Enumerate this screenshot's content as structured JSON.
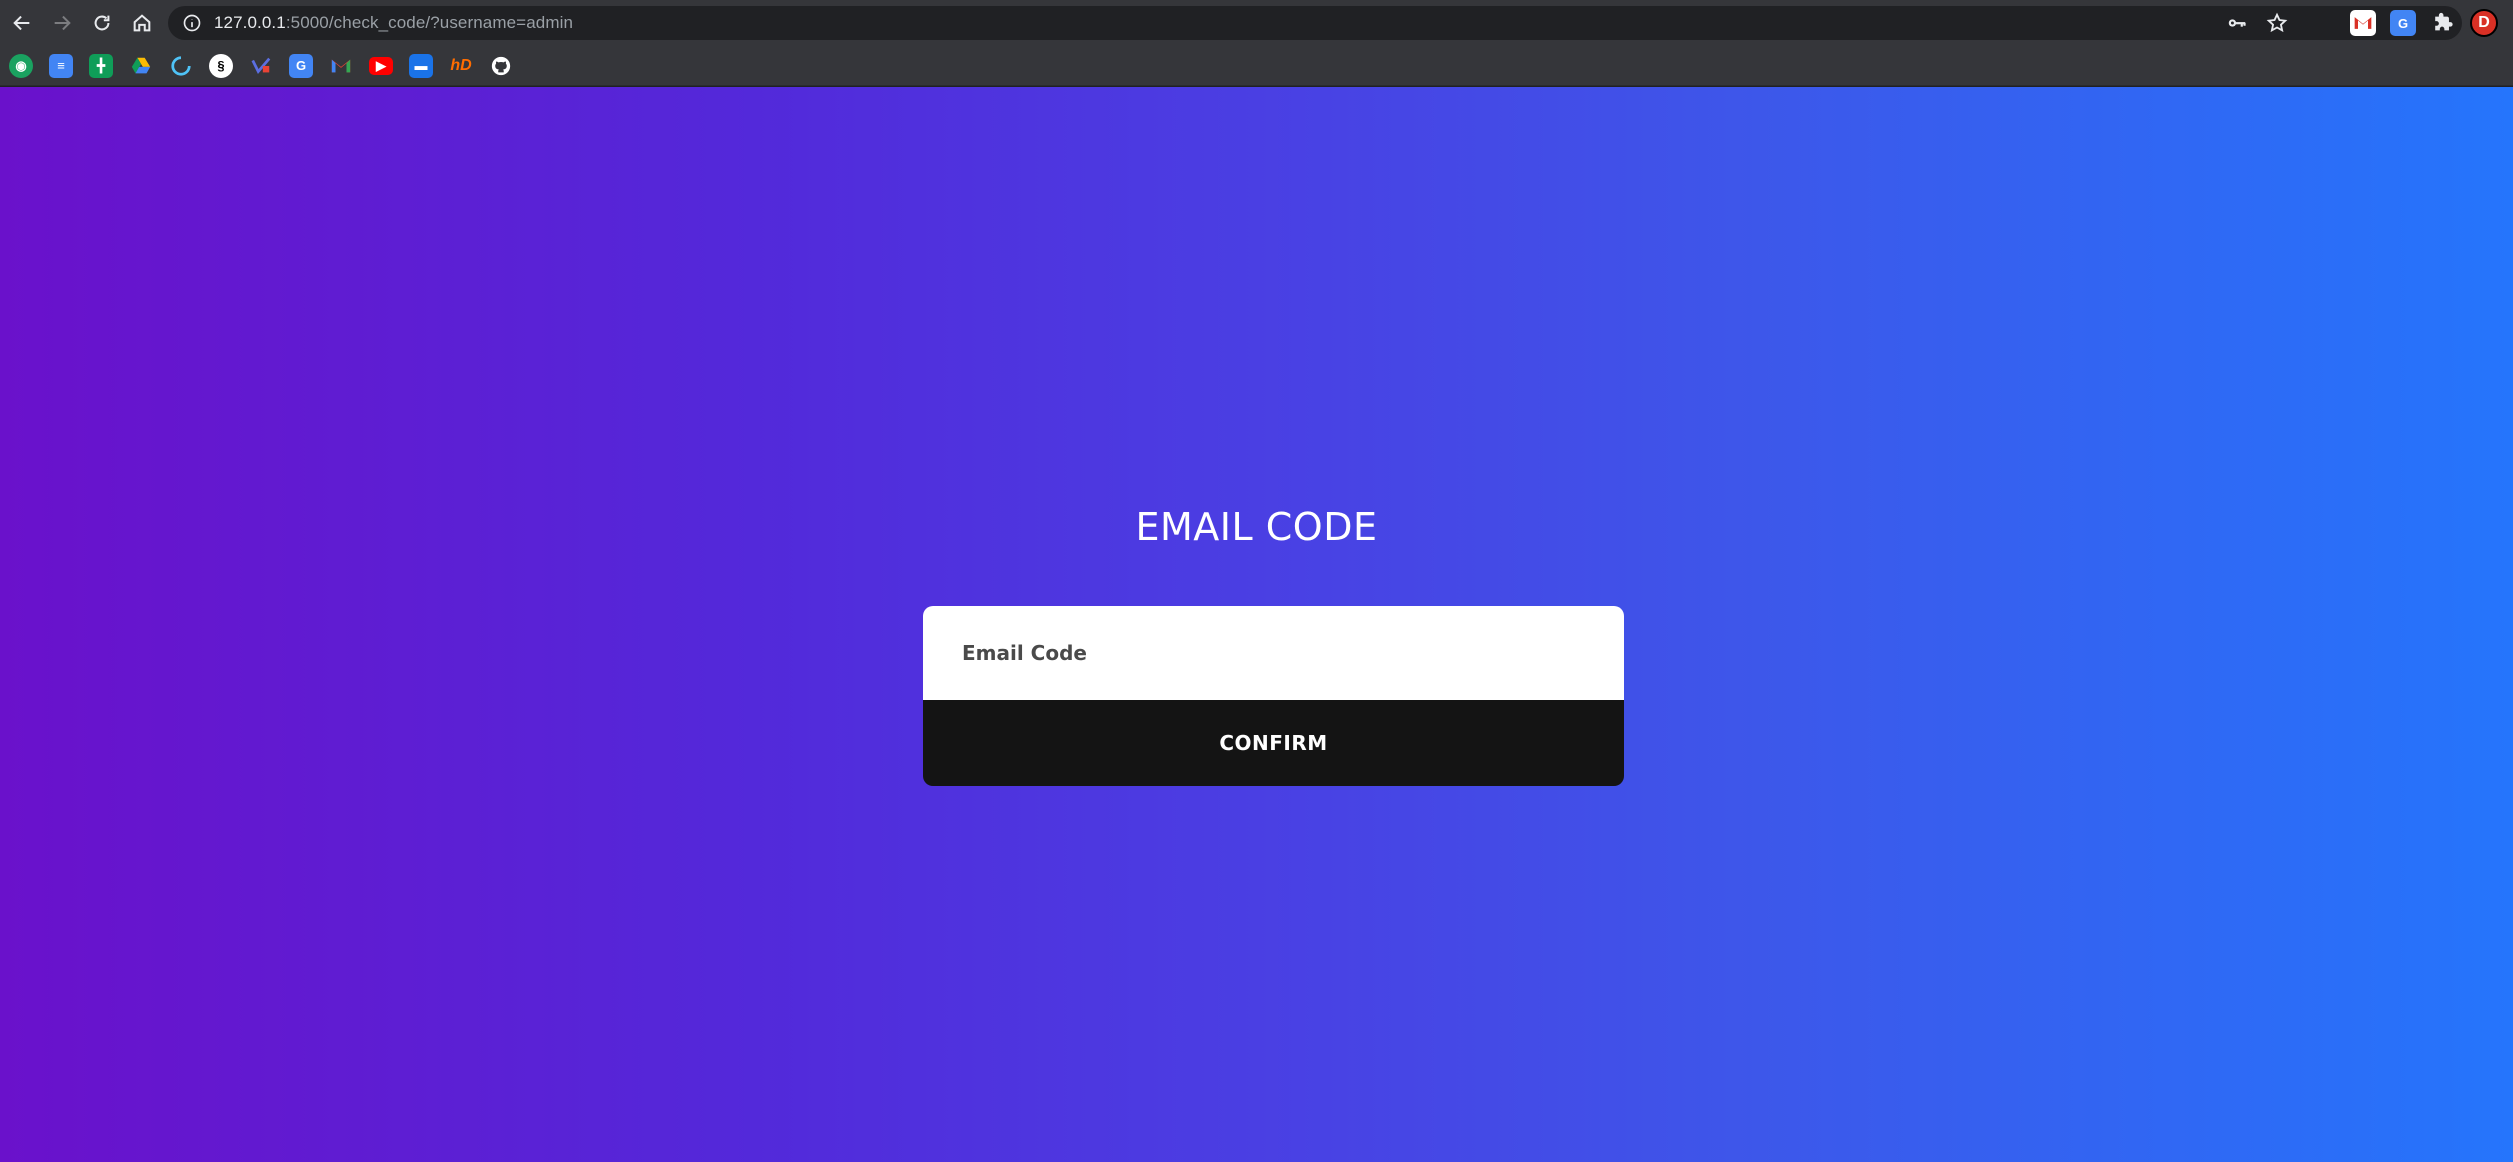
{
  "browser": {
    "url_host": "127.0.0.1",
    "url_rest": ":5000/check_code/?username=admin",
    "profile_initial": "D",
    "icons": {
      "back": "back-arrow-icon",
      "forward": "forward-arrow-icon",
      "reload": "reload-icon",
      "home": "home-icon",
      "info": "site-info-icon",
      "key": "password-key-icon",
      "star": "bookmark-star-icon",
      "extensions": "puzzle-extensions-icon"
    },
    "extensions": [
      {
        "name": "gmail-extension-icon",
        "color": "#d93025"
      },
      {
        "name": "translate-extension-icon",
        "color": "#4285f4"
      }
    ],
    "bookmarks": [
      {
        "name": "bookmark-globe-icon",
        "color": "#1aa260"
      },
      {
        "name": "bookmark-docs-icon",
        "color": "#4285f4"
      },
      {
        "name": "bookmark-sheets-icon",
        "color": "#0f9d58"
      },
      {
        "name": "bookmark-drive-icon",
        "color": "#fbbc04"
      },
      {
        "name": "bookmark-loader-icon",
        "color": "#4fc3f7"
      },
      {
        "name": "bookmark-s-icon",
        "color": "#000000"
      },
      {
        "name": "bookmark-check-icon",
        "color": "#5b6ee1"
      },
      {
        "name": "bookmark-translate-icon",
        "color": "#4285f4"
      },
      {
        "name": "bookmark-gmail-icon",
        "color": "#ea4335"
      },
      {
        "name": "bookmark-youtube-icon",
        "color": "#ff0000"
      },
      {
        "name": "bookmark-chat-icon",
        "color": "#1a73e8"
      },
      {
        "name": "bookmark-hd-icon",
        "color": "#ff6d00"
      },
      {
        "name": "bookmark-github-icon",
        "color": "#ffffff"
      }
    ]
  },
  "page": {
    "title": "EMAIL CODE",
    "input_placeholder": "Email Code",
    "confirm_label": "CONFIRM",
    "gradient_start": "#6a11cb",
    "gradient_end": "#2575fc"
  }
}
